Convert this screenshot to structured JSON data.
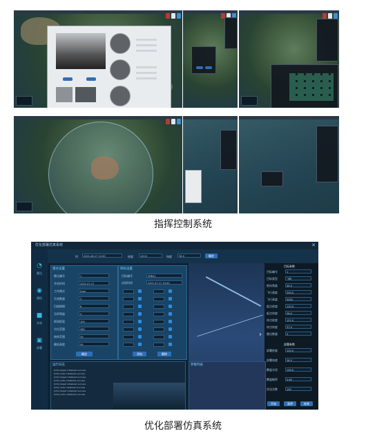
{
  "captions": {
    "top": "指挥控制系统",
    "bottom": "优化部署仿真系统"
  },
  "opt": {
    "title": "优化部署仿真系统",
    "nav": [
      {
        "label": "雷达",
        "icon": "radar-icon"
      },
      {
        "label": "通信",
        "icon": "signal-icon"
      },
      {
        "label": "光电",
        "icon": "camera-icon"
      },
      {
        "label": "部署",
        "icon": "deploy-icon"
      }
    ],
    "toolbar": {
      "field1_label": "时",
      "field1_value": "2021-08-17 12:00",
      "field2_label": "经度",
      "field2_value": "120.0",
      "field3_label": "纬度",
      "field3_value": "36.0",
      "action": "确定"
    },
    "left_panel": {
      "title": "雷达设置",
      "rows": [
        {
          "label": "雷达编号",
          "value": "1"
        },
        {
          "label": "开机时间",
          "value": "2021-07-17"
        },
        {
          "label": "工作模式",
          "value": "Scan"
        },
        {
          "label": "天线数量",
          "value": "3"
        },
        {
          "label": "扫描周期",
          "value": "6"
        },
        {
          "label": "功率等级",
          "value": "4"
        },
        {
          "label": "探测距离",
          "value": "100"
        },
        {
          "label": "方位范围",
          "value": "360"
        },
        {
          "label": "俯仰范围",
          "value": "30"
        },
        {
          "label": "最低高度",
          "value": "50"
        }
      ],
      "button": "确定"
    },
    "mid_panel": {
      "title": "目标设置",
      "rows": [
        {
          "label": "目标编号",
          "value": "目标01"
        },
        {
          "label": "出现时间",
          "value": "2021-07-17 10:00"
        }
      ],
      "buttons": [
        "添加",
        "删除"
      ]
    },
    "right_panel": {
      "section1_title": "目标参数",
      "section2_title": "部署参数",
      "params": [
        {
          "label": "目标编号",
          "value": "1"
        },
        {
          "label": "目标类型",
          "value": "飞机"
        },
        {
          "label": "航向角度",
          "value": "45.0"
        },
        {
          "label": "飞行速度",
          "value": "300.0"
        },
        {
          "label": "飞行高度",
          "value": "5000"
        },
        {
          "label": "起点经度",
          "value": "120.0"
        },
        {
          "label": "起点纬度",
          "value": "36.0"
        },
        {
          "label": "终点经度",
          "value": "121.0"
        },
        {
          "label": "终点纬度",
          "value": "37.0"
        },
        {
          "label": "雷达数量",
          "value": "3"
        }
      ],
      "deploy": [
        {
          "label": "部署经度",
          "value": "120.5"
        },
        {
          "label": "部署纬度",
          "value": "36.5"
        },
        {
          "label": "覆盖半径",
          "value": "100.0"
        },
        {
          "label": "覆盖概率",
          "value": "0.85"
        },
        {
          "label": "优化次数",
          "value": "100"
        }
      ],
      "buttons": [
        "开始",
        "暂停",
        "结束"
      ]
    },
    "log": {
      "title": "运行日志",
      "lines": [
        "[Info] target initialized success",
        "[Info] radar initialized success",
        "[Info] target initialized success",
        "[Info] radar initialized success",
        "[Info] target initialized success",
        "[Info] radar initialized success",
        "[Info] target initialized success",
        "[Info] radar initialized success"
      ]
    },
    "param_list": {
      "title": "参数列表"
    }
  }
}
